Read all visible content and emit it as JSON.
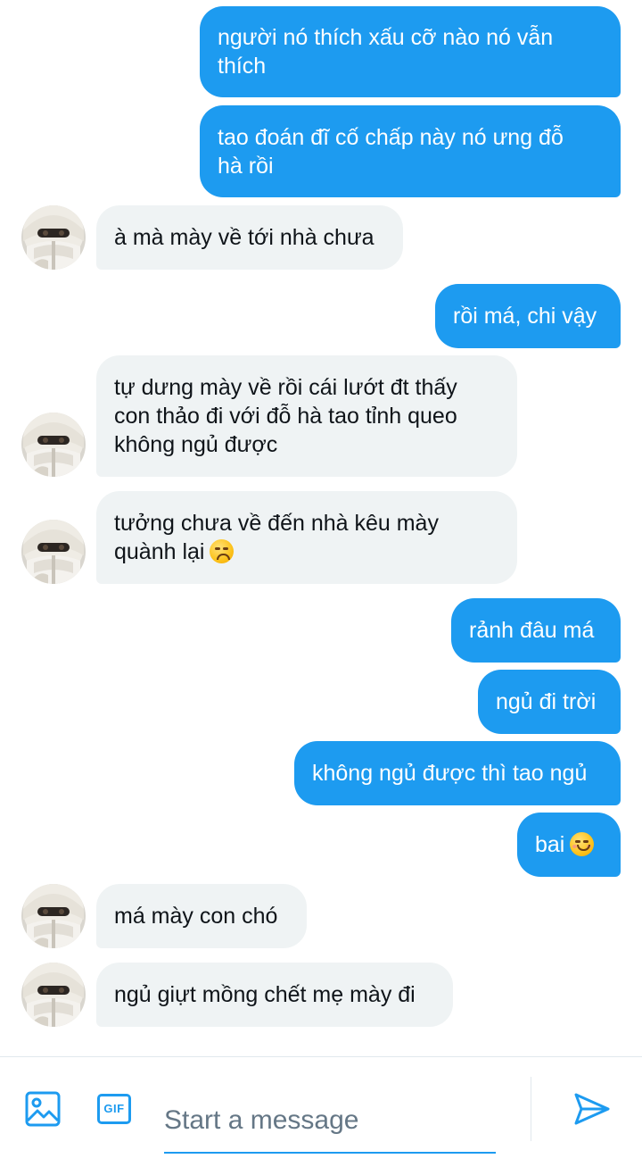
{
  "conversation": {
    "messages": [
      {
        "direction": "out",
        "lines": [
          "người nó thích xấu cỡ nào nó vẫn",
          "thích"
        ]
      },
      {
        "direction": "out",
        "lines": [
          "tao đoán đĩ cố chấp này nó ưng đỗ",
          "hà rồi"
        ]
      },
      {
        "direction": "in",
        "lines": [
          "à mà mày về tới nhà chưa"
        ]
      },
      {
        "direction": "out",
        "lines": [
          "rồi má, chi vậy"
        ]
      },
      {
        "direction": "in",
        "lines": [
          "tự dưng mày về rồi cái lướt đt thấy",
          "con thảo đi với đỗ hà tao tỉnh queo",
          "không ngủ được"
        ]
      },
      {
        "direction": "in",
        "lines": [
          "tưởng chưa về đến nhà kêu mày",
          "quành lại"
        ],
        "emoji": "disappointed-face"
      },
      {
        "direction": "out",
        "lines": [
          "rảnh đâu má"
        ]
      },
      {
        "direction": "out",
        "lines": [
          "ngủ đi trời"
        ]
      },
      {
        "direction": "out",
        "lines": [
          "không ngủ được thì tao ngủ"
        ]
      },
      {
        "direction": "out",
        "lines": [
          "bai"
        ],
        "emoji": "smiling-face"
      },
      {
        "direction": "in",
        "lines": [
          "má mày con chó"
        ]
      },
      {
        "direction": "in",
        "lines": [
          "ngủ giựt mồng chết mẹ mày đi"
        ]
      }
    ]
  },
  "composer": {
    "placeholder": "Start a message",
    "value": "",
    "gif_label": "GIF",
    "icons": [
      "image-icon",
      "gif-icon",
      "send-icon"
    ]
  },
  "colors": {
    "accent": "#1d9bf0",
    "incoming_bubble": "#eff3f4",
    "outgoing_text": "#ffffff",
    "incoming_text": "#0f1419",
    "placeholder": "#657786"
  }
}
